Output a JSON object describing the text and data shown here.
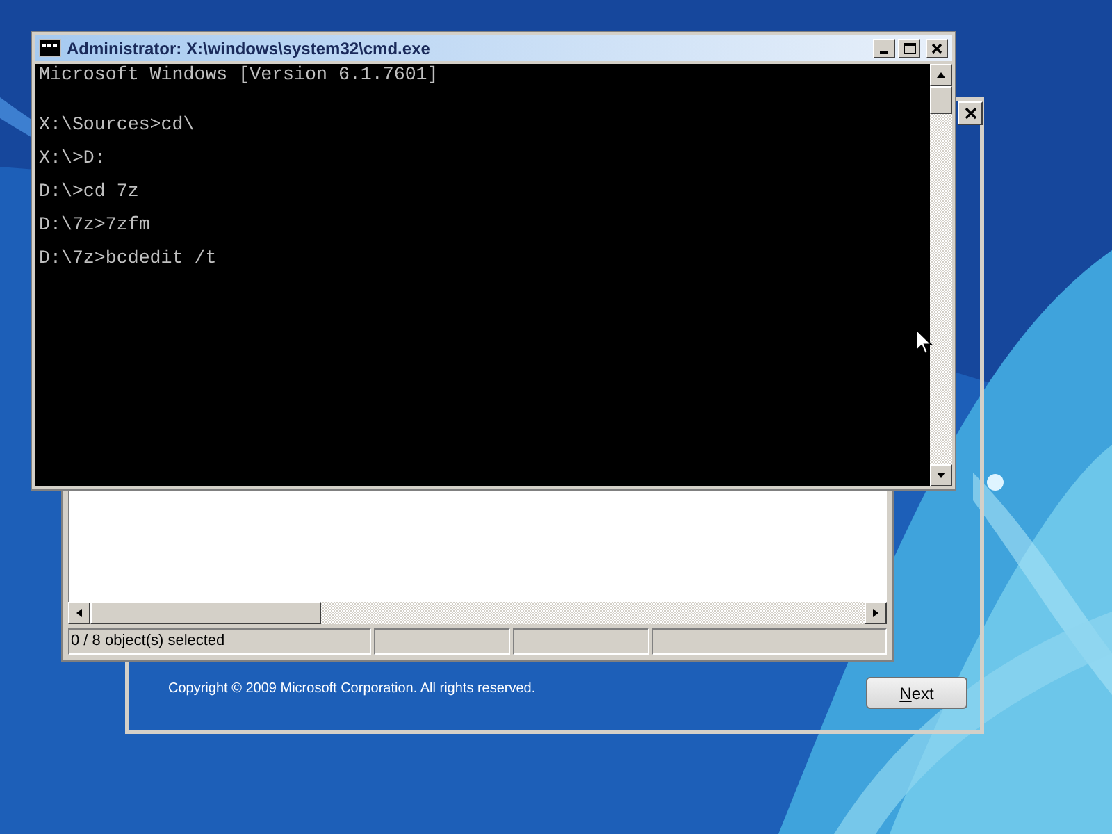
{
  "cmd_window": {
    "title": "Administrator: X:\\windows\\system32\\cmd.exe",
    "lines": [
      "Microsoft Windows [Version 6.1.7601]",
      "X:\\Sources>cd\\",
      "X:\\>D:",
      "D:\\>cd 7z",
      "D:\\7z>7zfm",
      "D:\\7z>bcdedit /t"
    ]
  },
  "file_manager": {
    "status_text": "0 / 8 object(s) selected"
  },
  "setup_window": {
    "copyright": "Copyright © 2009 Microsoft Corporation. All rights reserved.",
    "next_button": "Next"
  }
}
